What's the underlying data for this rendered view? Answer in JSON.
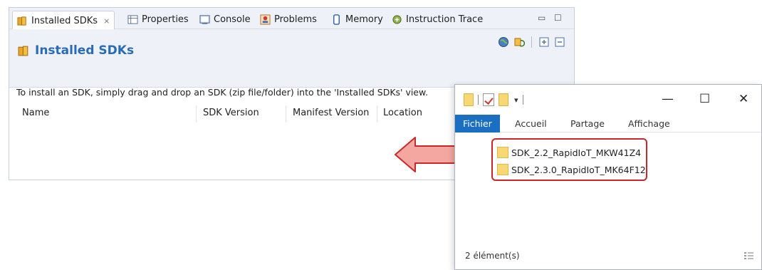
{
  "eclipse": {
    "tabs": [
      {
        "label": "Installed SDKs",
        "icon": "sdk-package-icon",
        "active": true
      },
      {
        "label": "Properties",
        "icon": "properties-icon"
      },
      {
        "label": "Console",
        "icon": "console-icon"
      },
      {
        "label": "Problems",
        "icon": "problems-icon"
      },
      {
        "label": "Memory",
        "icon": "memory-icon"
      },
      {
        "label": "Instruction Trace",
        "icon": "instruction-trace-icon"
      }
    ],
    "tab_close_glyph": "⨯",
    "minimize_glyph": "▭",
    "maximize_glyph": "☐",
    "page_title": "Installed SDKs",
    "instruction": "To install an SDK, simply drag and drop an SDK (zip file/folder) into the 'Installed SDKs' view.",
    "columns": [
      "Name",
      "SDK Version",
      "Manifest Version",
      "Location"
    ],
    "toolbar_icons": [
      "globe-icon",
      "refresh-sdk-icon",
      "expand-all-icon",
      "collapse-all-icon"
    ]
  },
  "explorer": {
    "ribbon_tabs": [
      "Fichier",
      "Accueil",
      "Partage",
      "Affichage"
    ],
    "window_controls": {
      "minimize": "—",
      "maximize": "☐",
      "close": "✕"
    },
    "items": [
      "SDK_2.2_RapidIoT_MKW41Z4",
      "SDK_2.3.0_RapidIoT_MK64F12"
    ],
    "status": "2 élément(s)"
  },
  "colors": {
    "accent_blue": "#2a6cb3",
    "ribbon_active": "#1a6fc2",
    "highlight_red": "#c8282a",
    "arrow_fill": "#f4a7a0"
  }
}
